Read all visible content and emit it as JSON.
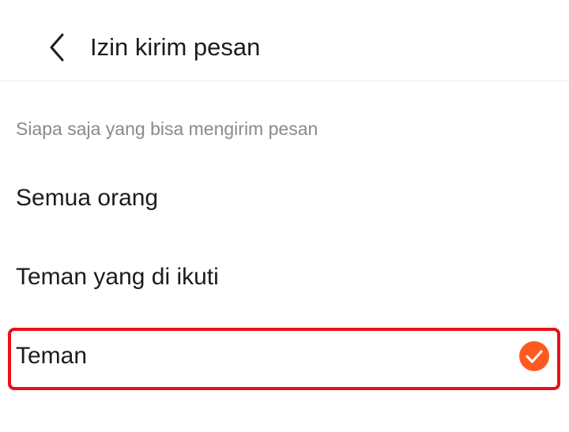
{
  "header": {
    "title": "Izin kirim pesan"
  },
  "section": {
    "label": "Siapa saja yang bisa mengirim pesan"
  },
  "options": [
    {
      "label": "Semua orang",
      "selected": false
    },
    {
      "label": "Teman yang di ikuti",
      "selected": false
    },
    {
      "label": "Teman",
      "selected": true
    }
  ],
  "colors": {
    "accent": "#fe5a1f",
    "highlight": "#e8101a"
  },
  "icons": {
    "back": "chevron-left-icon",
    "selected": "check-circle-icon"
  }
}
